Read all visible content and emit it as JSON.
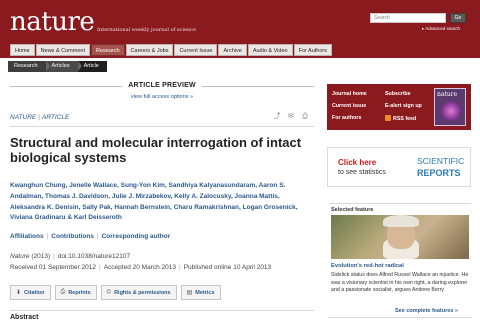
{
  "header": {
    "logo": "nature",
    "tagline": "International weekly journal of science",
    "search_placeholder": "Search",
    "go_label": "Go",
    "advanced_search": "Advanced search",
    "nav": [
      {
        "label": "Home"
      },
      {
        "label": "News & Comment"
      },
      {
        "label": "Research"
      },
      {
        "label": "Careers & Jobs"
      },
      {
        "label": "Current Issue"
      },
      {
        "label": "Archive"
      },
      {
        "label": "Audio & Video"
      },
      {
        "label": "For Authors"
      }
    ],
    "active_nav": "Research",
    "accent_color": "#8b1a1f"
  },
  "breadcrumb": [
    "Research",
    "Articles",
    "Article"
  ],
  "preview": {
    "heading": "ARTICLE PREVIEW",
    "link": "view full access options"
  },
  "article": {
    "journal": "NATURE",
    "type": "ARTICLE",
    "title": "Structural and molecular interrogation of intact biological systems",
    "authors": "Kwanghun Chung, Jenelle Wallace, Sung-Yon Kim, Sandhiya Kalyanasundaram, Aaron S. Andalman, Thomas J. Davidson, Julie J. Mirzabekov, Kelly A. Zalocusky, Joanna Mattis, Aleksandra K. Denisin, Sally Pak, Hannah Bernstein, Charu Ramakrishnan, Logan Grosenick, Viviana Gradinaru & Karl Deisseroth",
    "aff_links": [
      "Affiliations",
      "Contributions",
      "Corresponding author"
    ],
    "citation_journal": "Nature",
    "citation_year": "(2013)",
    "doi": "doi:10.1038/nature12107",
    "received": "Received 01 September 2012",
    "accepted": "Accepted 20 March 2013",
    "published": "Published online 10 April 2013",
    "buttons": [
      {
        "label": "Citation",
        "icon": "download-icon"
      },
      {
        "label": "Reprints",
        "icon": "printer-icon"
      },
      {
        "label": "Rights & permissions",
        "icon": "copyright-icon"
      },
      {
        "label": "Metrics",
        "icon": "chart-icon"
      }
    ],
    "abstract_heading": "Abstract"
  },
  "journal_box": {
    "links": [
      "Journal home",
      "Current issue",
      "For authors",
      "Subscribe",
      "E-alert sign up",
      "RSS feed"
    ],
    "cover_title": "nature"
  },
  "ad": {
    "click": "Click here",
    "to_see": "to see statistics",
    "brand_line1": "SCIENTIFIC",
    "brand_line2": "REPORTS"
  },
  "selected_feature": {
    "heading": "Selected feature",
    "title": "Evolution's red-hot radical",
    "text": "Sidelick status does Alfred Russel Wallace an injustice. He was a visionary scientist in his own right, a daring explorer and a passionate socialist, argues Andrew Berry",
    "more": "See complete features"
  }
}
